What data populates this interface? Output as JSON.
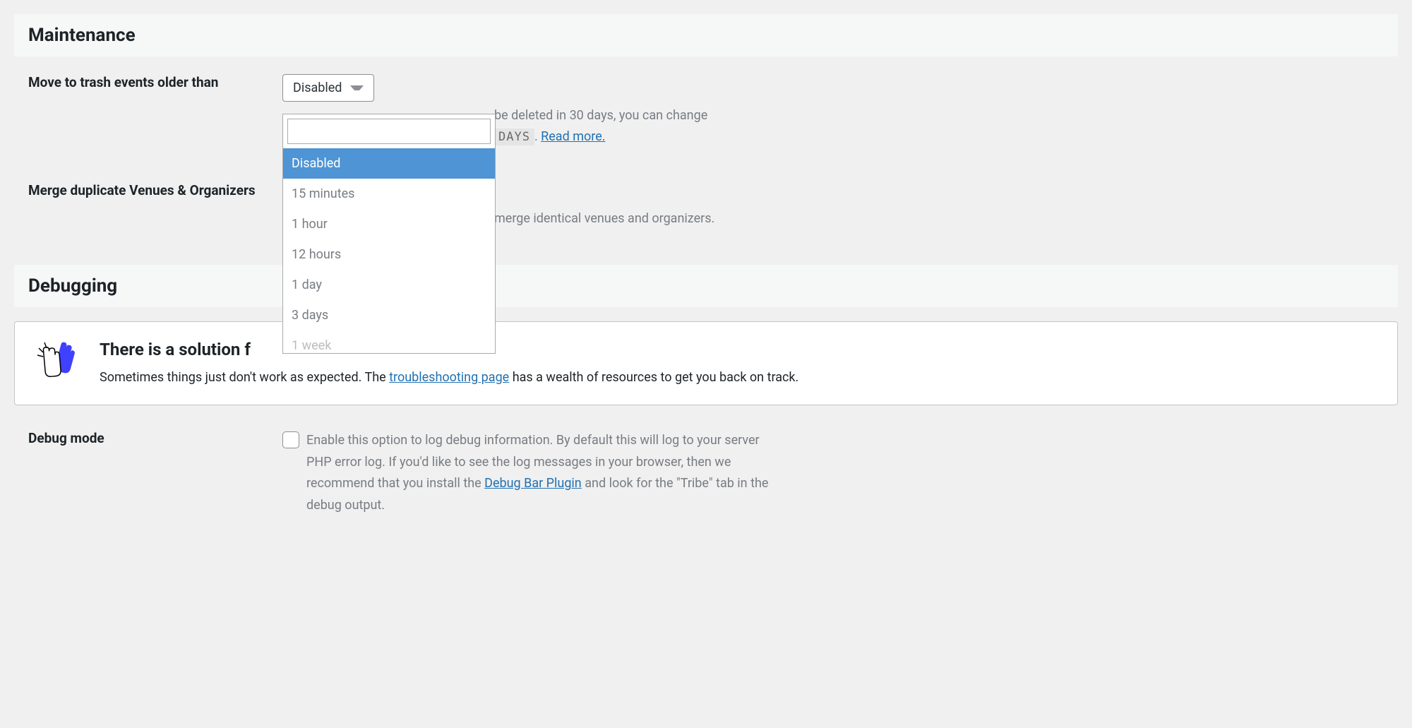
{
  "maintenance": {
    "header": "Maintenance",
    "trash_label": "Move to trash events older than",
    "trash_select_value": "Disabled",
    "dropdown_options": [
      "Disabled",
      "15 minutes",
      "1 hour",
      "12 hours",
      "1 day",
      "3 days",
      "1 week"
    ],
    "trash_help_prefix": "be deleted in 30 days, you can change",
    "trash_help_code": "DAYS",
    "trash_help_dot": ". ",
    "trash_help_link": "Read more.",
    "merge_label": "Merge duplicate Venues & Organizers",
    "merge_help": "merge identical venues and organizers."
  },
  "debugging": {
    "header": "Debugging",
    "notice_title": "There is a solution f",
    "notice_text_pre": "Sometimes things just don't work as expected. The ",
    "notice_link": "troubleshooting page",
    "notice_text_post": " has a wealth of resources to get you back on track.",
    "debug_mode_label": "Debug mode",
    "debug_mode_text_pre": "Enable this option to log debug information. By default this will log to your server PHP error log. If you'd like to see the log messages in your browser, then we recommend that you install the ",
    "debug_mode_link": "Debug Bar Plugin",
    "debug_mode_text_post": " and look for the \"Tribe\" tab in the debug output."
  }
}
